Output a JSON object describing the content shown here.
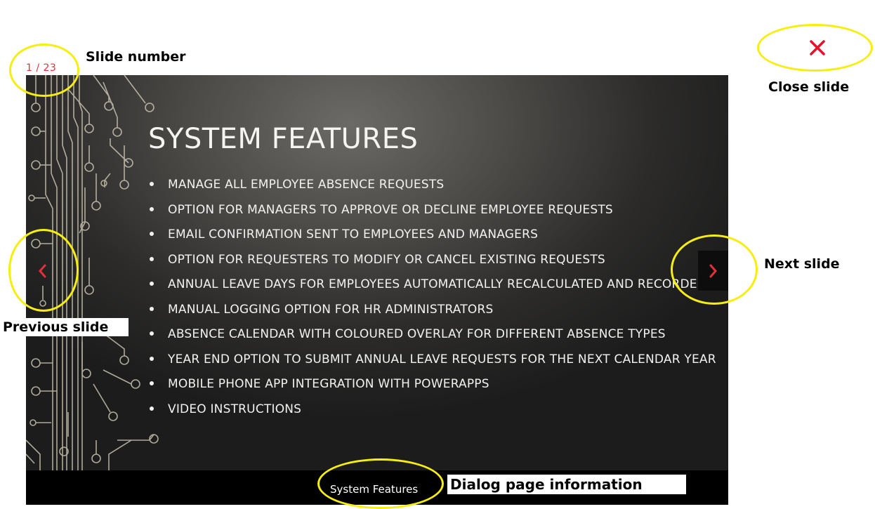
{
  "viewer": {
    "slide_counter": "1 / 23",
    "close_icon": "close-icon",
    "prev_icon": "chevron-left-icon",
    "next_icon": "chevron-right-icon",
    "accent_color": "#e0303a"
  },
  "slide": {
    "title": "SYSTEM FEATURES",
    "bullets": [
      "MANAGE ALL EMPLOYEE ABSENCE REQUESTS",
      "OPTION FOR MANAGERS TO APPROVE OR DECLINE EMPLOYEE REQUESTS",
      "EMAIL CONFIRMATION SENT TO EMPLOYEES AND MANAGERS",
      "OPTION FOR REQUESTERS TO MODIFY OR CANCEL EXISTING REQUESTS",
      "ANNUAL LEAVE DAYS FOR EMPLOYEES AUTOMATICALLY RECALCULATED AND RECORDED",
      "MANUAL LOGGING OPTION FOR HR ADMINISTRATORS",
      "ABSENCE CALENDAR WITH COLOURED OVERLAY FOR DIFFERENT ABSENCE TYPES",
      "YEAR END OPTION TO SUBMIT ANNUAL LEAVE REQUESTS FOR THE NEXT CALENDAR YEAR",
      "MOBILE PHONE APP INTEGRATION WITH POWERAPPS",
      "VIDEO INSTRUCTIONS"
    ]
  },
  "caption": {
    "text": "System Features"
  },
  "annotations": {
    "slide_number": "Slide number",
    "close_slide": "Close slide",
    "next_slide": "Next slide",
    "previous_slide": "Previous slide",
    "dialog_info": "Dialog page information",
    "highlight_color": "#f6ee12"
  }
}
